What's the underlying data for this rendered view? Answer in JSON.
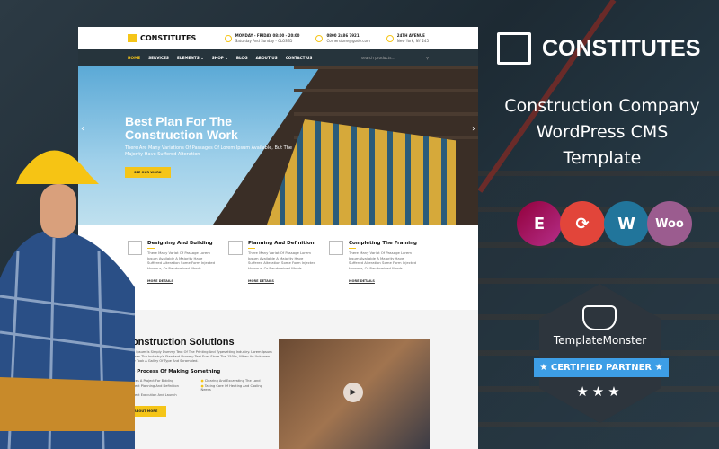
{
  "brand": {
    "name": "CONSTITUTES",
    "subtitle": [
      "Construction Company",
      "WordPress CMS",
      "Template"
    ]
  },
  "site": {
    "logo": "CONSTITUTES",
    "info": [
      {
        "icon": "clock-icon",
        "title": "MONDAY - FRIDAY 08:00 - 20:00",
        "text": "Saturday And Sunday - CLOSED"
      },
      {
        "icon": "phone-icon",
        "title": "0800 2486 7921",
        "text": "Cornerstone@gode.com"
      },
      {
        "icon": "location-pin-icon",
        "title": "24TH AVENUE",
        "text": "New York, NY 245"
      }
    ],
    "nav": [
      "HOME",
      "SERVICES",
      "ELEMENTS ⌄",
      "SHOP ⌄",
      "BLOG",
      "ABOUT US",
      "CONTACT US"
    ],
    "search_placeholder": "search products...",
    "hero": {
      "title_1": "Best Plan For The",
      "title_2": "Construction Work",
      "text": "There Are Many Variations Of Passages Of Lorem Ipsum Available, But The Majority Have Suffered Alteration",
      "button": "SEE OUR WORK"
    },
    "features": [
      {
        "icon": "house-icon",
        "title": "Designing And Building",
        "text": "There Many Variat Of Passage Lorem Ipsum Available A Majority Have Suffered Alteration Some Form Injected Humour, Or Randomised Words.",
        "link": "MORE DETAILS"
      },
      {
        "icon": "set-square-icon",
        "title": "Planning And Definition",
        "text": "There Many Variat Of Passage Lorem Ipsum Available A Majority Have Suffered Alteration Some Form Injected Humour, Or Randomised Words.",
        "link": "MORE DETAILS"
      },
      {
        "icon": "tools-icon",
        "title": "Completing The Framing",
        "text": "There Many Variat Of Passage Lorem Ipsum Available A Majority Have Suffered Alteration Some Form Injected Humour, Or Randomised Words.",
        "link": "MORE DETAILS"
      }
    ],
    "solutions": {
      "title": "Construction Solutions",
      "text": "Lorem Ipsum Is Simply Dummy Text Of The Printing And Typesetting Industry. Lorem Ipsum Has Been The Industry's Standard Dummy Text Ever Since The 1500s, When An Unknown Printer Took A Galley Of Type And Scrambled.",
      "subtitle": "The Process Of Making Something",
      "items": [
        "Places A Project For Bidding",
        "Clearing And Excavating The Land",
        "Project Planning And Definition",
        "Taking Care Of Heating And Cooling Needs",
        "Project Execution And Launch"
      ],
      "button": "ABOUT MORE"
    }
  },
  "plugins": [
    {
      "name": "elementor",
      "label": "E",
      "color": "#92003b"
    },
    {
      "name": "updates",
      "label": "⟳",
      "color": "#e2453a"
    },
    {
      "name": "wordpress",
      "label": "W",
      "color": "#21759b"
    },
    {
      "name": "woocommerce",
      "label": "Woo",
      "color": "#9b5c8f"
    }
  ],
  "badge": {
    "brand": "TemplateMonster",
    "label": "CERTIFIED PARTNER",
    "stars": "★★★"
  }
}
